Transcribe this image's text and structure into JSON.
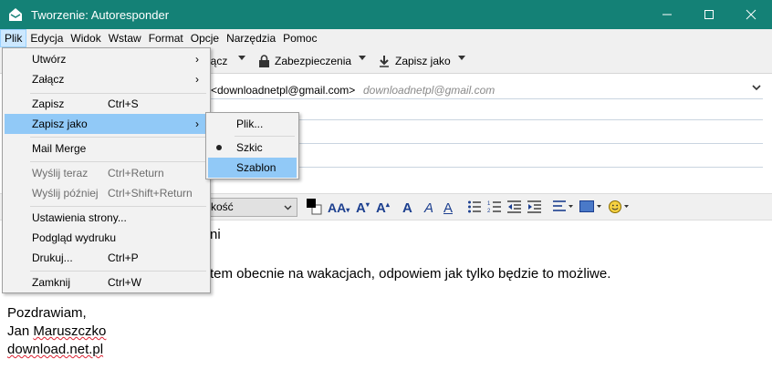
{
  "window": {
    "title": "Tworzenie: Autoresponder",
    "controls": [
      "minimize-icon",
      "maximize-icon",
      "close-icon"
    ]
  },
  "menubar": [
    "Plik",
    "Edycja",
    "Widok",
    "Wstaw",
    "Format",
    "Opcje",
    "Narzędzia",
    "Pomoc"
  ],
  "toolbar": {
    "attach_partial": "łącz",
    "security": "Zabezpieczenia",
    "save_as": "Zapisz jako"
  },
  "header": {
    "from_value": "<downloadnetpl@gmail.com>",
    "from_hint": "downloadnetpl@gmail.com"
  },
  "formatbar": {
    "font_partial": "kość",
    "buttons": [
      "color-icon",
      "font-size-smaller",
      "font-size-larger",
      "bold",
      "italic",
      "underline",
      "bullet-list",
      "numbered-list",
      "outdent",
      "indent",
      "align",
      "insert-image",
      "emoji"
    ]
  },
  "body_lines": [
    "ni",
    "tem obecnie na wakacjach, odpowiem jak tylko będzie to możliwe.",
    "Pozdrawiam,",
    "Jan Maruszczko",
    "download.net.pl"
  ],
  "file_menu": {
    "items": [
      {
        "label": "Utwórz",
        "shortcut": "",
        "submenu": true,
        "disabled": false
      },
      {
        "label": "Załącz",
        "shortcut": "",
        "submenu": true,
        "disabled": false
      },
      {
        "label": "Zapisz",
        "shortcut": "Ctrl+S",
        "submenu": false,
        "disabled": false
      },
      {
        "label": "Zapisz jako",
        "shortcut": "",
        "submenu": true,
        "disabled": false,
        "hover": true
      },
      {
        "label": "Mail Merge",
        "shortcut": "",
        "submenu": false,
        "disabled": false
      },
      {
        "label": "Wyślij teraz",
        "shortcut": "Ctrl+Return",
        "submenu": false,
        "disabled": true
      },
      {
        "label": "Wyślij później",
        "shortcut": "Ctrl+Shift+Return",
        "submenu": false,
        "disabled": true
      },
      {
        "label": "Ustawienia strony...",
        "shortcut": "",
        "submenu": false,
        "disabled": false
      },
      {
        "label": "Podgląd wydruku",
        "shortcut": "",
        "submenu": false,
        "disabled": false
      },
      {
        "label": "Drukuj...",
        "shortcut": "Ctrl+P",
        "submenu": false,
        "disabled": false
      },
      {
        "label": "Zamknij",
        "shortcut": "Ctrl+W",
        "submenu": false,
        "disabled": false
      }
    ]
  },
  "save_as_submenu": {
    "items": [
      {
        "label": "Plik..."
      },
      {
        "label": "Szkic",
        "checked": true
      },
      {
        "label": "Szablon",
        "hover": true
      }
    ]
  },
  "colors": {
    "titlebar": "#148176",
    "menu_hover": "#91c9f7",
    "spell_underline": "#dd2233"
  }
}
